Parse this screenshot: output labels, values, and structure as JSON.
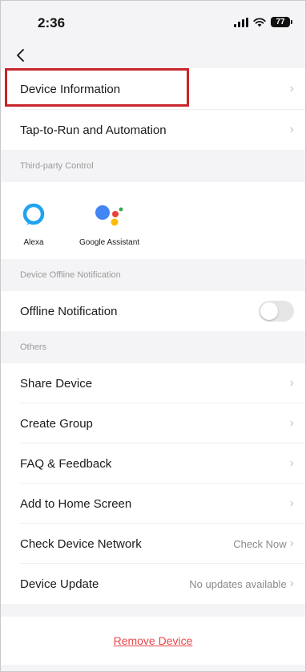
{
  "status_bar": {
    "time": "2:36",
    "battery": "77"
  },
  "nav": {
    "back_icon": "chevron-left-icon"
  },
  "rows_top": [
    {
      "label": "Device Information"
    },
    {
      "label": "Tap-to-Run and Automation"
    }
  ],
  "third_party": {
    "header": "Third-party Control",
    "items": [
      {
        "label": "Alexa",
        "icon": "alexa-icon"
      },
      {
        "label": "Google Assistant",
        "icon": "google-assistant-icon"
      }
    ]
  },
  "offline": {
    "header": "Device Offline Notification",
    "label": "Offline Notification",
    "enabled": false
  },
  "others": {
    "header": "Others",
    "items": [
      {
        "label": "Share Device",
        "value": ""
      },
      {
        "label": "Create Group",
        "value": ""
      },
      {
        "label": "FAQ & Feedback",
        "value": ""
      },
      {
        "label": "Add to Home Screen",
        "value": ""
      },
      {
        "label": "Check Device Network",
        "value": "Check Now"
      },
      {
        "label": "Device Update",
        "value": "No updates available"
      }
    ]
  },
  "remove": {
    "label": "Remove Device"
  },
  "colors": {
    "highlight": "#c8252c",
    "remove_text": "#e8464a",
    "alexa": "#1fa3f0",
    "google_blue": "#4285f4",
    "google_red": "#ea4335",
    "google_yellow": "#fbbc05",
    "google_green": "#34a853"
  }
}
